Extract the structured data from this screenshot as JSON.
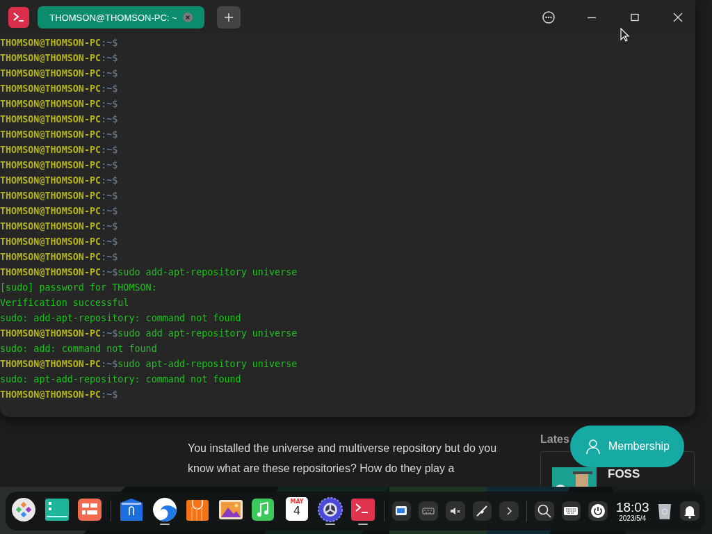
{
  "terminal": {
    "tab_title": "THOMSON@THOMSON-PC: ~",
    "lines": [
      {
        "kind": "prompt",
        "host": "THOMSON@THOMSON-PC",
        "path": ":~$"
      },
      {
        "kind": "prompt",
        "host": "THOMSON@THOMSON-PC",
        "path": ":~$"
      },
      {
        "kind": "prompt",
        "host": "THOMSON@THOMSON-PC",
        "path": ":~$"
      },
      {
        "kind": "prompt",
        "host": "THOMSON@THOMSON-PC",
        "path": ":~$"
      },
      {
        "kind": "prompt",
        "host": "THOMSON@THOMSON-PC",
        "path": ":~$"
      },
      {
        "kind": "prompt",
        "host": "THOMSON@THOMSON-PC",
        "path": ":~$"
      },
      {
        "kind": "prompt",
        "host": "THOMSON@THOMSON-PC",
        "path": ":~$"
      },
      {
        "kind": "prompt",
        "host": "THOMSON@THOMSON-PC",
        "path": ":~$"
      },
      {
        "kind": "prompt",
        "host": "THOMSON@THOMSON-PC",
        "path": ":~$"
      },
      {
        "kind": "prompt",
        "host": "THOMSON@THOMSON-PC",
        "path": ":~$"
      },
      {
        "kind": "prompt",
        "host": "THOMSON@THOMSON-PC",
        "path": ":~$"
      },
      {
        "kind": "prompt",
        "host": "THOMSON@THOMSON-PC",
        "path": ":~$"
      },
      {
        "kind": "prompt",
        "host": "THOMSON@THOMSON-PC",
        "path": ":~$"
      },
      {
        "kind": "prompt",
        "host": "THOMSON@THOMSON-PC",
        "path": ":~$"
      },
      {
        "kind": "prompt",
        "host": "THOMSON@THOMSON-PC",
        "path": ":~$"
      },
      {
        "kind": "prompt",
        "host": "THOMSON@THOMSON-PC",
        "path": ":~$",
        "command": "sudo add-apt-repository universe"
      },
      {
        "kind": "output",
        "text": "[sudo] password for THOMSON:"
      },
      {
        "kind": "output",
        "text": "Verification successful"
      },
      {
        "kind": "output",
        "text": "sudo: add-apt-repository: command not found"
      },
      {
        "kind": "prompt",
        "host": "THOMSON@THOMSON-PC",
        "path": ":~$",
        "command": "sudo add apt-repository universe"
      },
      {
        "kind": "output",
        "text": "sudo: add: command not found"
      },
      {
        "kind": "prompt",
        "host": "THOMSON@THOMSON-PC",
        "path": ":~$",
        "command": "sudo apt-add-repository universe"
      },
      {
        "kind": "output",
        "text": "sudo: apt-add-repository: command not found"
      },
      {
        "kind": "prompt",
        "host": "THOMSON@THOMSON-PC",
        "path": ":~$"
      }
    ]
  },
  "article": {
    "paragraph": "You installed the universe and multiverse repository but do you know what are these repositories? How do they play a",
    "sidebar_heading": "Lates",
    "card_title": "FOSS",
    "membership_button": "Membership"
  },
  "dock": {
    "apps": [
      {
        "kind": "launcher",
        "active": false
      },
      {
        "kind": "multitask",
        "active": false
      },
      {
        "kind": "workspace",
        "active": false
      },
      {
        "kind": "divider"
      },
      {
        "kind": "files",
        "active": false
      },
      {
        "kind": "browser",
        "active": true
      },
      {
        "kind": "store",
        "active": false
      },
      {
        "kind": "photos",
        "active": false
      },
      {
        "kind": "music",
        "active": false
      },
      {
        "kind": "calendar",
        "active": false,
        "month": "MAY",
        "day": "4"
      },
      {
        "kind": "settings",
        "active": true
      },
      {
        "kind": "terminal",
        "active": true
      }
    ],
    "tray": [
      {
        "kind": "chat"
      },
      {
        "kind": "keyboard-small"
      },
      {
        "kind": "mute"
      },
      {
        "kind": "pen"
      },
      {
        "kind": "expand"
      }
    ],
    "time": "18:03",
    "date": "2023/5/4"
  }
}
